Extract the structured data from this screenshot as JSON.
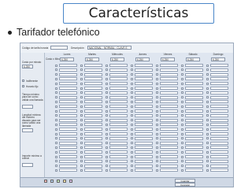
{
  "slide": {
    "title": "Características",
    "bullet": "Tarifador telefónico"
  },
  "app": {
    "code_label": "Código de tarifa horaria",
    "description_label": "Descripción",
    "description_value": "NACIONAL - NORMAL - CLAVE E",
    "days": [
      "Lunes",
      "Martes",
      "Miércoles",
      "Jueves",
      "Viernes",
      "Sábado",
      "Domingo"
    ],
    "cost_per_minute_label": "Costo por minuto",
    "cost_label": "Costo x Minuto",
    "cost_values": [
      "6,250",
      "6,250",
      "6,250",
      "6,250",
      "6,250",
      "6,250",
      "6,250"
    ],
    "left_cost_value": "6,250",
    "checkbox_labels": [
      "Indiferente",
      "Horario fijo"
    ],
    "left_labels": [
      "Tiempo mínimo para ser como válida una llamada",
      "Longitud mínima del número discado para ser como válido una llamada",
      "Importe mínimo a cobrar"
    ],
    "buttons": [
      "Guardar",
      "Cancelar"
    ]
  }
}
